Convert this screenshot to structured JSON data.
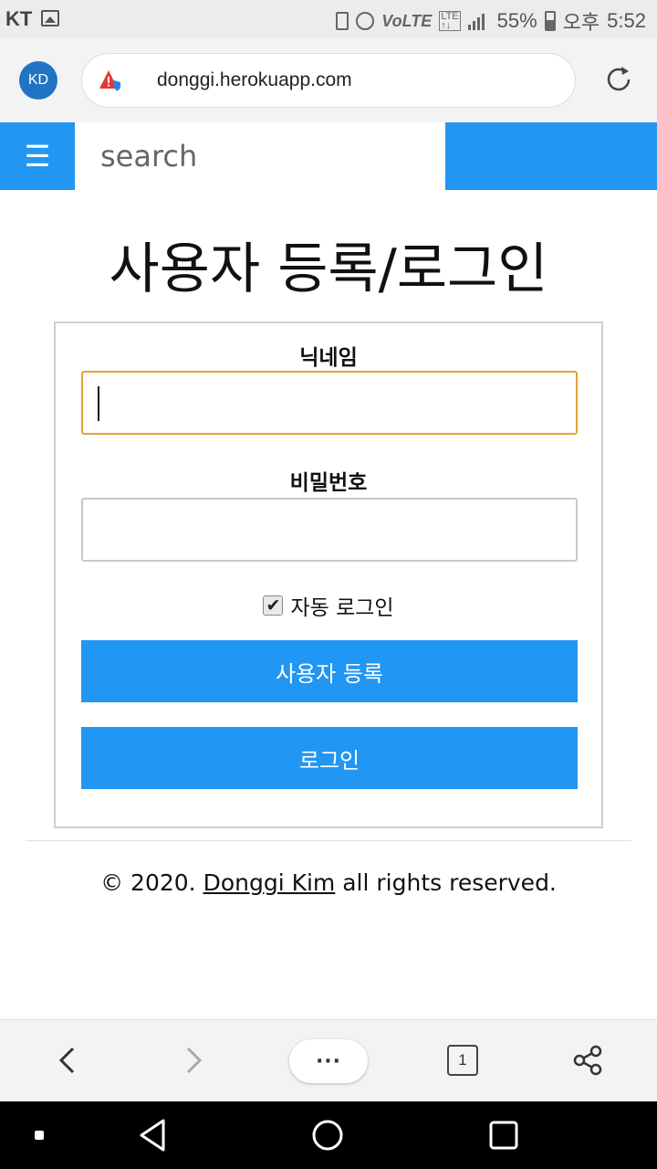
{
  "status_bar": {
    "carrier": "KT",
    "battery": "55%",
    "ampm": "오후",
    "time": "5:52"
  },
  "browser": {
    "avatar_initials": "KD",
    "url": "donggi.herokuapp.com",
    "open_tabs": "1",
    "more_label": "···"
  },
  "header": {
    "menu_icon": "☰",
    "search_placeholder": "search"
  },
  "main": {
    "title": "사용자 등록/로그인",
    "nickname_label": "닉네임",
    "nickname_value": "",
    "password_label": "비밀번호",
    "password_value": "",
    "auto_login_label": "자동 로그인",
    "auto_login_checked": true,
    "register_button": "사용자 등록",
    "login_button": "로그인"
  },
  "footer": {
    "prefix": "© 2020. ",
    "author": "Donggi Kim",
    "suffix": " all rights reserved."
  },
  "colors": {
    "accent": "#2196f3",
    "focus_border": "#e0a436",
    "avatar": "#2074c4"
  }
}
